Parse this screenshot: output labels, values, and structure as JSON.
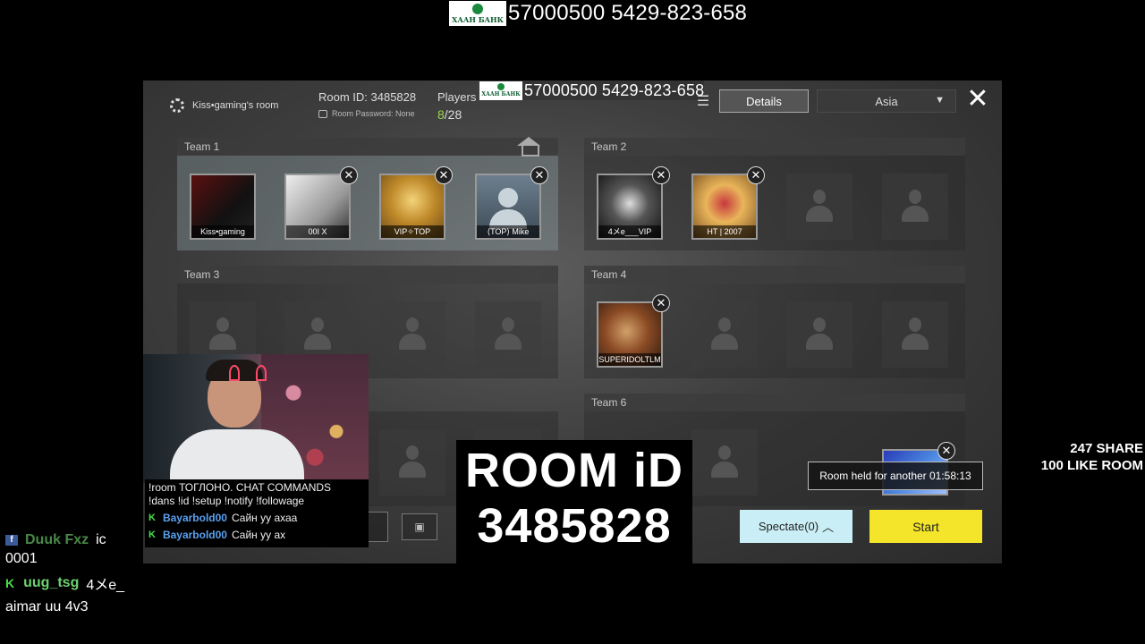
{
  "banner": {
    "bank_name": "ХААН БАНК",
    "account_text": "57000500 5429-823-658"
  },
  "header": {
    "room_owner": "Kiss•gaming's room",
    "room_id_label": "Room ID: 3485828",
    "room_password": "Room Password: None",
    "players_label": "Players",
    "players_current": "8",
    "players_max": "/28",
    "details_label": "Details",
    "region": "Asia",
    "inner_banner_text": "57000500 5429-823-658",
    "inner_bank_name": "ХААН БАНК"
  },
  "teams": [
    {
      "name": "Team 1",
      "players": [
        "Kiss•gaming",
        "00I X",
        "VIP✧TOP",
        "⟨TOP⟩ Mike"
      ]
    },
    {
      "name": "Team 2",
      "players": [
        "4メe___VIP",
        "HT | 2007"
      ]
    },
    {
      "name": "Team 3",
      "players": []
    },
    {
      "name": "Team 4",
      "players": [
        "SUPERIDOLTLM"
      ]
    },
    {
      "name": "Team 6",
      "players": []
    }
  ],
  "room_held": "Room held for another 01:58:13",
  "spectate_label": "Spectate(0)",
  "start_label": "Start",
  "chat_overlay": {
    "commands_line1": "!room ТОГЛОНО. CHAT COMMANDS",
    "commands_line2": "!dans !id !setup !notify !followage",
    "messages": [
      {
        "user": "Bayarbold00",
        "text": "Сайн уу ахаа"
      },
      {
        "user": "Bayarbold00",
        "text": "Сайн уу ах"
      }
    ]
  },
  "room_big": {
    "line1": "ROOM iD",
    "line2": "3485828"
  },
  "share": {
    "line1": "247 SHARE",
    "line2": "100 LIKE ROOM"
  },
  "bottom_chat": {
    "row1_user": "Duuk Fxz",
    "row1_trail": "ic",
    "row2_text": "0001",
    "row3_user": "uug_tsg",
    "row3_text": "4メe_",
    "row4_text": "aimar uu 4v3"
  },
  "colors": {
    "start_button": "#f4e52a",
    "spectate_button": "#c9eef5",
    "players_current": "#9bd44a",
    "chat_user": "#5aa0f0",
    "platform_icon": "#45e04a"
  }
}
